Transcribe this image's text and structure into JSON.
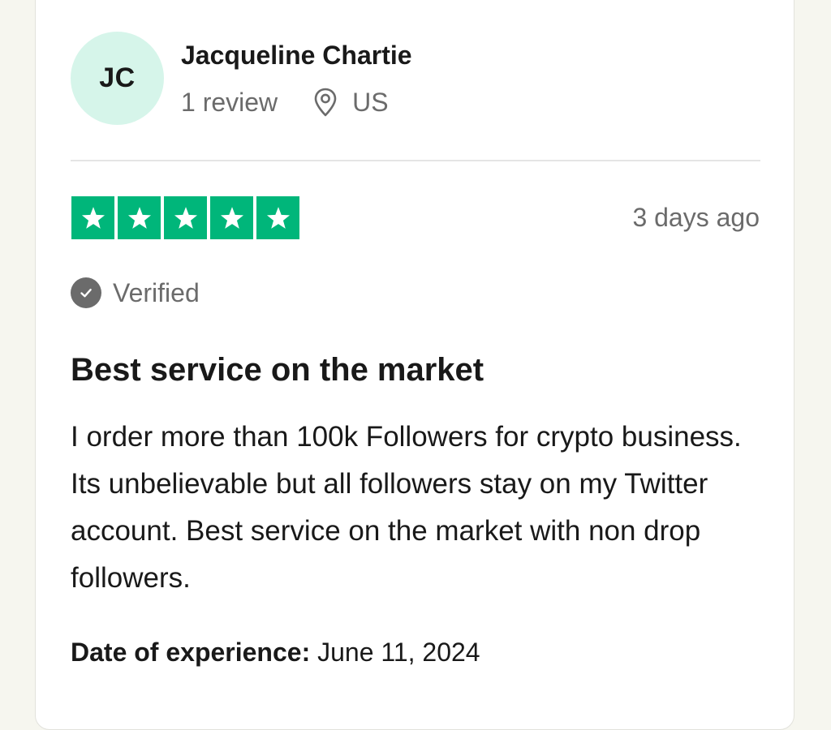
{
  "reviewer": {
    "initials": "JC",
    "name": "Jacqueline Chartie",
    "review_count": "1 review",
    "location_icon": "location-pin-icon",
    "country": "US"
  },
  "rating": {
    "stars": 5,
    "max_stars": 5,
    "star_color": "#00b67a",
    "posted": "3 days ago"
  },
  "verification": {
    "icon": "check-circle-icon",
    "label": "Verified"
  },
  "review": {
    "title": "Best service on the market",
    "body": "I order more than 100k Followers for crypto business. Its unbelievable but all followers stay on my Twitter account. Best service on the market with non drop followers."
  },
  "experience": {
    "label": "Date of experience:",
    "date": "June 11, 2024"
  },
  "colors": {
    "avatar_bg": "#d6f5ea",
    "text_primary": "#191919",
    "text_secondary": "#6b6b6b"
  }
}
